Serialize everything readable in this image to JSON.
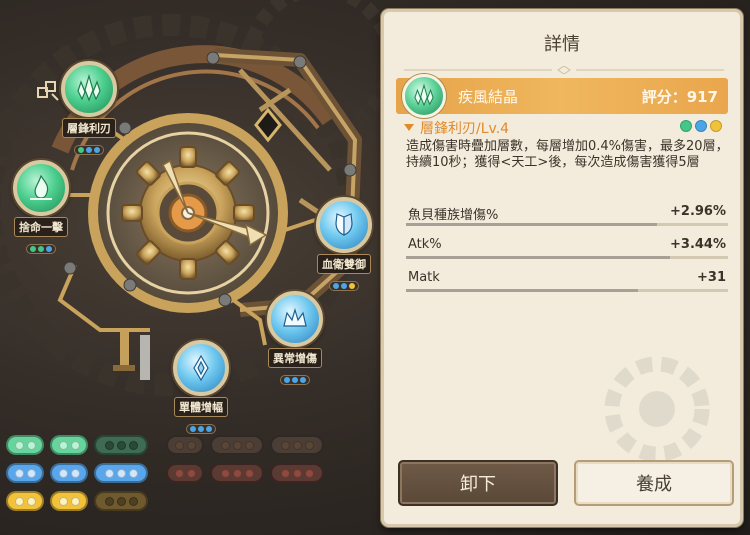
{
  "colors": {
    "panel_bg": "#f3ecdd",
    "accent_orange": "#e08a2a",
    "gem_bar": "#f0b75e",
    "green_gem": "#4ccf8e",
    "blue_gem": "#6ec8ee",
    "yellow_gem": "#f2c33a"
  },
  "nodes": [
    {
      "label": "層鋒利刃",
      "icon": "green-crystal-icon",
      "color": "green",
      "dots": [
        "#43c68a",
        "#4aa6e6",
        "#4aa6e6"
      ]
    },
    {
      "label": "捨命一擊",
      "icon": "green-flame-icon",
      "color": "green",
      "dots": [
        "#43c68a",
        "#43c68a",
        "#4aa6e6"
      ]
    },
    {
      "label": "血衛雙御",
      "icon": "blue-shield-icon",
      "color": "blue",
      "dots": [
        "#4aa6e6",
        "#4aa6e6",
        "#f2c33a"
      ]
    },
    {
      "label": "異常增傷",
      "icon": "blue-crown-icon",
      "color": "blue",
      "dots": [
        "#4aa6e6",
        "#4aa6e6",
        "#4aa6e6"
      ]
    },
    {
      "label": "單體增幅",
      "icon": "blue-drop-icon",
      "color": "blue",
      "dots": [
        "#4aa6e6",
        "#4aa6e6",
        "#4aa6e6"
      ]
    }
  ],
  "slot_rows": [
    {
      "row_color": "green",
      "left": [
        {
          "size": 2,
          "fill": "#66d49c",
          "dot": "#b9f3d5"
        },
        {
          "size": 2,
          "fill": "#66d49c",
          "dot": "#b9f3d5"
        },
        {
          "size": 3,
          "fill": "#3e6b52",
          "dot": "#2a4a38"
        }
      ],
      "right": [
        {
          "size": 2,
          "fill": "#4a3e36",
          "dot": "#5a4636"
        },
        {
          "size": 3,
          "fill": "#4a3e36",
          "dot": "#5a4636"
        },
        {
          "size": 3,
          "fill": "#4a3e36",
          "dot": "#5a4636"
        }
      ]
    },
    {
      "row_color": "blue",
      "left": [
        {
          "size": 2,
          "fill": "#5aa6ea",
          "dot": "#cfe8ff"
        },
        {
          "size": 2,
          "fill": "#5aa6ea",
          "dot": "#cfe8ff"
        },
        {
          "size": 3,
          "fill": "#5aa6ea",
          "dot": "#cfe8ff"
        }
      ],
      "right": [
        {
          "size": 2,
          "fill": "#5a3a32",
          "dot": "#8e4a3e"
        },
        {
          "size": 3,
          "fill": "#5a3a32",
          "dot": "#8e4a3e"
        },
        {
          "size": 3,
          "fill": "#5a3a32",
          "dot": "#8e4a3e"
        }
      ]
    },
    {
      "row_color": "yellow",
      "left": [
        {
          "size": 2,
          "fill": "#f2c33a",
          "dot": "#fff1b8"
        },
        {
          "size": 2,
          "fill": "#f2c33a",
          "dot": "#fff1b8"
        },
        {
          "size": 3,
          "fill": "#6e5a2e",
          "dot": "#4e4022"
        }
      ],
      "right": []
    }
  ],
  "panel": {
    "title": "詳情",
    "gem": {
      "name": "疾風結晶",
      "score_label": "評分：917",
      "icon": "green-crystal-icon"
    },
    "skill": {
      "title": "層鋒利刃/Lv.4",
      "dots": [
        "#43c68a",
        "#4aa6e6",
        "#f2c33a"
      ],
      "description": "造成傷害時疊加層數，每層增加0.4%傷害，最多20層，持續10秒；獲得<天工>後，每次造成傷害獲得5層"
    },
    "stats": [
      {
        "name": "魚貝種族增傷%",
        "value": "+2.96%",
        "fill": 0.78
      },
      {
        "name": "Atk%",
        "value": "+3.44%",
        "fill": 0.82
      },
      {
        "name": "Matk",
        "value": "+31",
        "fill": 0.72
      }
    ],
    "buttons": {
      "unequip": "卸下",
      "upgrade": "養成"
    }
  }
}
